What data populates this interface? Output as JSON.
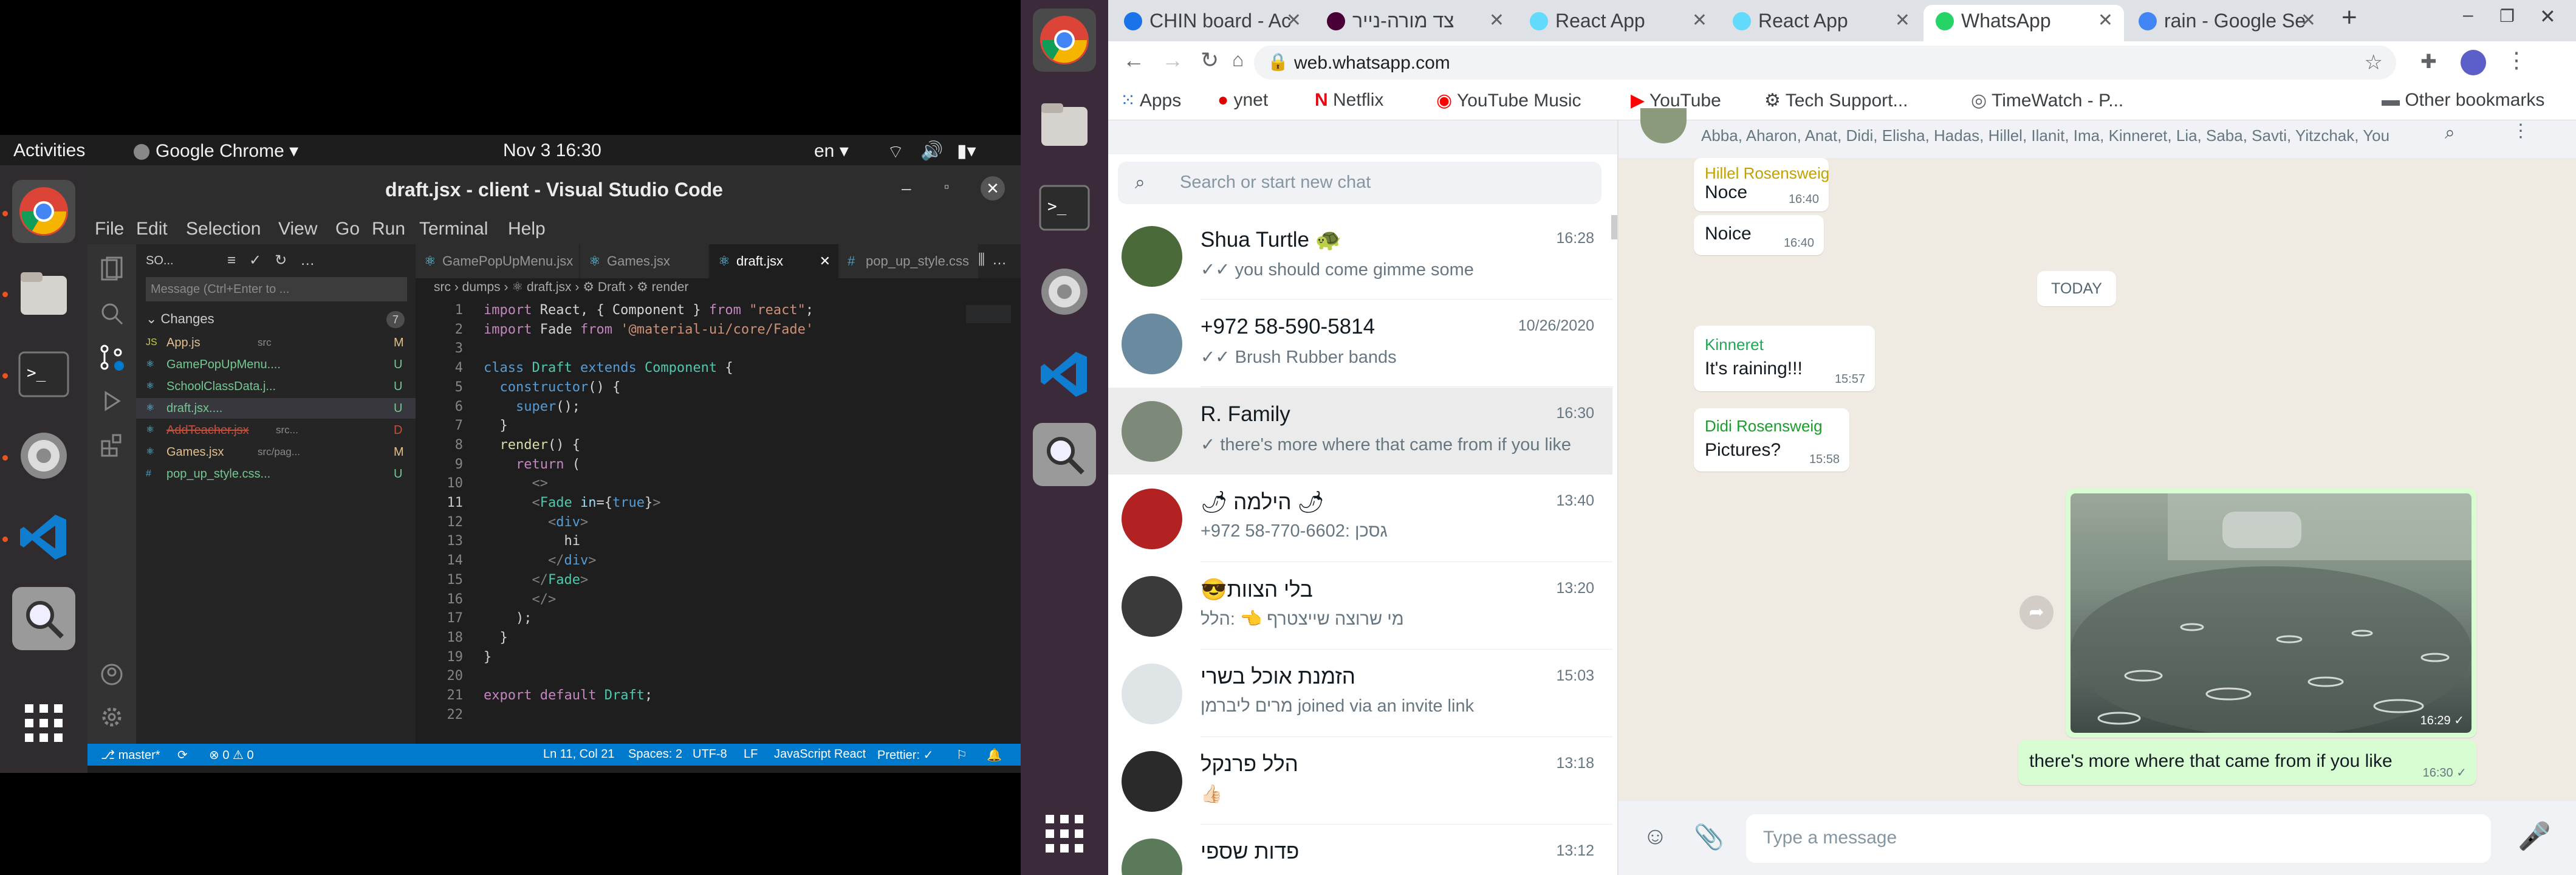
{
  "desktop": {
    "activities": "Activities",
    "app_menu": "Google Chrome ▾",
    "clock": "Nov 3  16:30",
    "lang": "en ▾"
  },
  "vscode": {
    "title": "draft.jsx - client - Visual Studio Code",
    "menu": [
      "File",
      "Edit",
      "Selection",
      "View",
      "Go",
      "Run",
      "Terminal",
      "Help"
    ],
    "sidebar": {
      "header": "SO...",
      "message_placeholder": "Message (Ctrl+Enter to ...",
      "changes_label": "Changes",
      "changes_count": "7",
      "files": [
        {
          "name": "App.js",
          "path": "src",
          "status": "M",
          "icon": "JS"
        },
        {
          "name": "GamePopUpMenu....",
          "path": "",
          "status": "U",
          "icon": "⚛"
        },
        {
          "name": "SchoolClassData.j...",
          "path": "",
          "status": "U",
          "icon": "⚛"
        },
        {
          "name": "draft.jsx....",
          "path": "",
          "status": "U",
          "icon": "⚛"
        },
        {
          "name": "AddTeacher.jsx",
          "path": "src...",
          "status": "D",
          "icon": "⚛"
        },
        {
          "name": "Games.jsx",
          "path": "src/pag...",
          "status": "M",
          "icon": "⚛"
        },
        {
          "name": "pop_up_style.css...",
          "path": "",
          "status": "U",
          "icon": "#"
        }
      ]
    },
    "tabs": [
      "GamePopUpMenu.jsx",
      "Games.jsx",
      "draft.jsx",
      "pop_up_style.css"
    ],
    "breadcrumb": "src › dumps › ⚛ draft.jsx › ⚙ Draft › ⚙ render",
    "status": {
      "branch": "master*",
      "errors": "⊗ 0 ⚠ 0",
      "position": "Ln 11, Col 21",
      "spaces": "Spaces: 2",
      "encoding": "UTF-8",
      "eol": "LF",
      "language": "JavaScript React",
      "prettier": "Prettier: ✓"
    }
  },
  "chrome": {
    "tabs": [
      {
        "title": "CHIN board - Ac",
        "fav": "#1a73e8"
      },
      {
        "title": "צד מורה-נייר",
        "fav": "#470137"
      },
      {
        "title": "React App",
        "fav": "#61dafb"
      },
      {
        "title": "React App",
        "fav": "#61dafb"
      },
      {
        "title": "WhatsApp",
        "fav": "#25d366"
      },
      {
        "title": "rain - Google Se",
        "fav": "#4285f4"
      }
    ],
    "url": "web.whatsapp.com",
    "bookmarks": [
      "Apps",
      "ynet",
      "Netflix",
      "YouTube Music",
      "YouTube",
      "Tech Support...",
      "TimeWatch - P...",
      "Other bookmarks"
    ]
  },
  "whatsapp": {
    "group_members": "Abba, Aharon, Anat, Didi, Elisha, Hadas, Hillel, Ilanit, Ima, Kinneret, Lia, Saba, Savti, Yitzchak, You",
    "search_placeholder": "Search or start new chat",
    "chats": [
      {
        "name": "Shua Turtle 🐢",
        "time": "16:28",
        "msg": "✓✓ you should come gimme some",
        "color": "#4a6a3a"
      },
      {
        "name": "+972 58-590-5814",
        "time": "10/26/2020",
        "msg": "✓✓ Brush Rubber bands",
        "color": "#6a8aa0"
      },
      {
        "name": "R. Family",
        "time": "16:30",
        "msg": "✓ there's more where that came from if you like",
        "color": "#7d8a7a"
      },
      {
        "name": "🌶 הילמה 🌶",
        "time": "13:40",
        "msg": "+972 58-770-6602: גסכן",
        "color": "#b22222"
      },
      {
        "name": "😎בלי הצוות",
        "time": "13:20",
        "msg": "מי שרוצה שייצטרף 👈 :הלל",
        "color": "#3a3a3a"
      },
      {
        "name": "הזמנת אוכל בשרי",
        "time": "15:03",
        "msg": "מרים ליברמן joined via an invite link",
        "color": "#dfe5e7"
      },
      {
        "name": "הלל פרנקל",
        "time": "13:18",
        "msg": "👍🏻",
        "color": "#2a2a2a"
      },
      {
        "name": "פדות שספי",
        "time": "13:12",
        "msg": "",
        "color": "#5a7a5a"
      }
    ],
    "messages": {
      "m1_sender": "Hillel Rosensweig",
      "m1_text": "Noce",
      "m1_time": "16:40",
      "m2_text": "Noice",
      "m2_time": "16:40",
      "today": "TODAY",
      "m3_sender": "Kinneret",
      "m3_text": "It's raining!!!",
      "m3_time": "15:57",
      "m4_sender": "Didi Rosensweig",
      "m4_text": "Pictures?",
      "m4_time": "15:58",
      "img_time": "16:29 ✓",
      "out_text": "there's more where that came from if you like",
      "out_time": "16:30 ✓"
    },
    "composer_placeholder": "Type a message"
  }
}
